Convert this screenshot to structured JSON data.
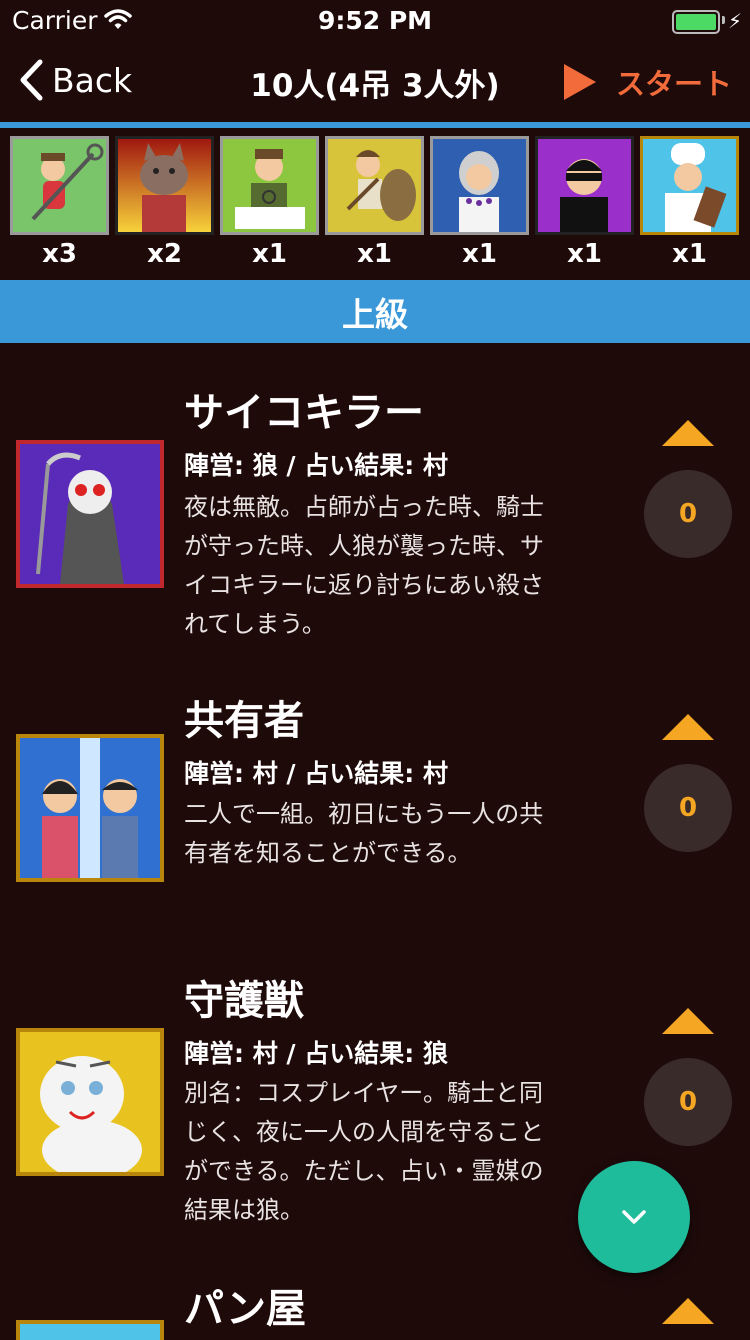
{
  "status_bar": {
    "carrier": "Carrier",
    "time": "9:52 PM"
  },
  "nav": {
    "back_label": "Back",
    "title": "10人(4吊 3人外)",
    "start_label": "スタート"
  },
  "roster": [
    {
      "role": "hunter",
      "count": "x3"
    },
    {
      "role": "werewolf",
      "count": "x2"
    },
    {
      "role": "seer",
      "count": "x1"
    },
    {
      "role": "caveman",
      "count": "x1"
    },
    {
      "role": "medium",
      "count": "x1"
    },
    {
      "role": "thief",
      "count": "x1"
    },
    {
      "role": "baker",
      "count": "x1"
    }
  ],
  "section": {
    "title": "上級"
  },
  "roles": [
    {
      "name": "サイコキラー",
      "meta": "陣営: 狼 / 占い結果: 村",
      "desc": [
        "夜は無敵。占師が占った時、騎士",
        "が守った時、人狼が襲った時、サ",
        "イコキラーに返り討ちにあい殺さ",
        "れてしまう。"
      ],
      "count": "0",
      "portrait": "psycho-killer"
    },
    {
      "name": "共有者",
      "meta": "陣営: 村 / 占い結果: 村",
      "desc": [
        "二人で一組。初日にもう一人の共",
        "有者を知ることができる。"
      ],
      "count": "0",
      "portrait": "freemasons"
    },
    {
      "name": "守護獣",
      "meta": "陣営: 村 / 占い結果: 狼",
      "desc": [
        "別名：コスプレイヤー。騎士と同",
        "じく、夜に一人の人間を守ること",
        "ができる。ただし、占い・霊媒の",
        "結果は狼。"
      ],
      "count": "0",
      "portrait": "guardian-beast"
    },
    {
      "name": "パン屋",
      "meta": "",
      "desc": [],
      "count": "",
      "portrait": "baker"
    }
  ],
  "colors": {
    "accent_blue": "#3a98d9",
    "start_orange": "#f26b3a",
    "counter_orange": "#f5a623",
    "fab_green": "#1ebc9b",
    "background": "#1f0a0a"
  }
}
